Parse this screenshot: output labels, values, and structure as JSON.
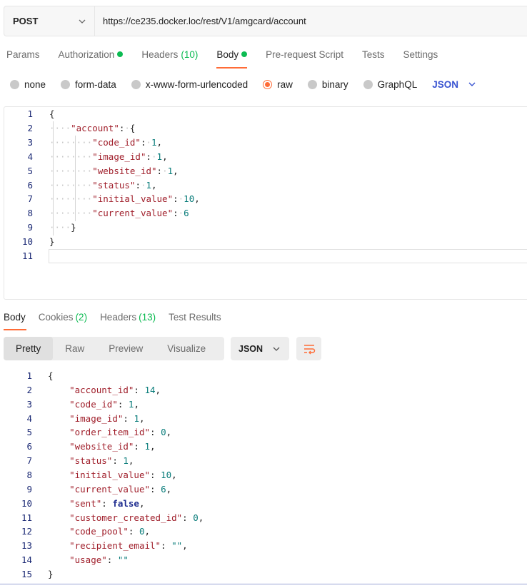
{
  "request": {
    "method": "POST",
    "url": "https://ce235.docker.loc/rest/V1/amgcard/account"
  },
  "request_tabs": [
    {
      "label": "Params"
    },
    {
      "label": "Authorization"
    },
    {
      "label": "Headers",
      "count": "(10)"
    },
    {
      "label": "Body"
    },
    {
      "label": "Pre-request Script"
    },
    {
      "label": "Tests"
    },
    {
      "label": "Settings"
    }
  ],
  "body_types": [
    {
      "label": "none"
    },
    {
      "label": "form-data"
    },
    {
      "label": "x-www-form-urlencoded"
    },
    {
      "label": "raw"
    },
    {
      "label": "binary"
    },
    {
      "label": "GraphQL"
    }
  ],
  "body_language": "JSON",
  "request_body": {
    "line_numbers": [
      "1",
      "2",
      "3",
      "4",
      "5",
      "6",
      "7",
      "8",
      "9",
      "10",
      "11"
    ],
    "lines": [
      "{",
      "    \"account\": {",
      "        \"code_id\": 1,",
      "        \"image_id\": 1,",
      "        \"website_id\": 1,",
      "        \"status\": 1,",
      "        \"initial_value\": 10,",
      "        \"current_value\": 6",
      "    }",
      "}",
      ""
    ]
  },
  "response_tabs": [
    {
      "label": "Body"
    },
    {
      "label": "Cookies",
      "count": "(2)"
    },
    {
      "label": "Headers",
      "count": "(13)"
    },
    {
      "label": "Test Results"
    }
  ],
  "response_views": [
    "Pretty",
    "Raw",
    "Preview",
    "Visualize"
  ],
  "response_format": "JSON",
  "response_body": {
    "line_numbers": [
      "1",
      "2",
      "3",
      "4",
      "5",
      "6",
      "7",
      "8",
      "9",
      "10",
      "11",
      "12",
      "13",
      "14",
      "15"
    ],
    "lines": [
      "{",
      "    \"account_id\": 14,",
      "    \"code_id\": 1,",
      "    \"image_id\": 1,",
      "    \"order_item_id\": 0,",
      "    \"website_id\": 1,",
      "    \"status\": 1,",
      "    \"initial_value\": 10,",
      "    \"current_value\": 6,",
      "    \"sent\": false,",
      "    \"customer_created_id\": 0,",
      "    \"code_pool\": 0,",
      "    \"recipient_email\": \"\",",
      "    \"usage\": \"\"",
      "}"
    ]
  },
  "colors": {
    "accent": "#ff6c37",
    "status_green": "#0cbb52",
    "language_blue": "#3853d1"
  }
}
